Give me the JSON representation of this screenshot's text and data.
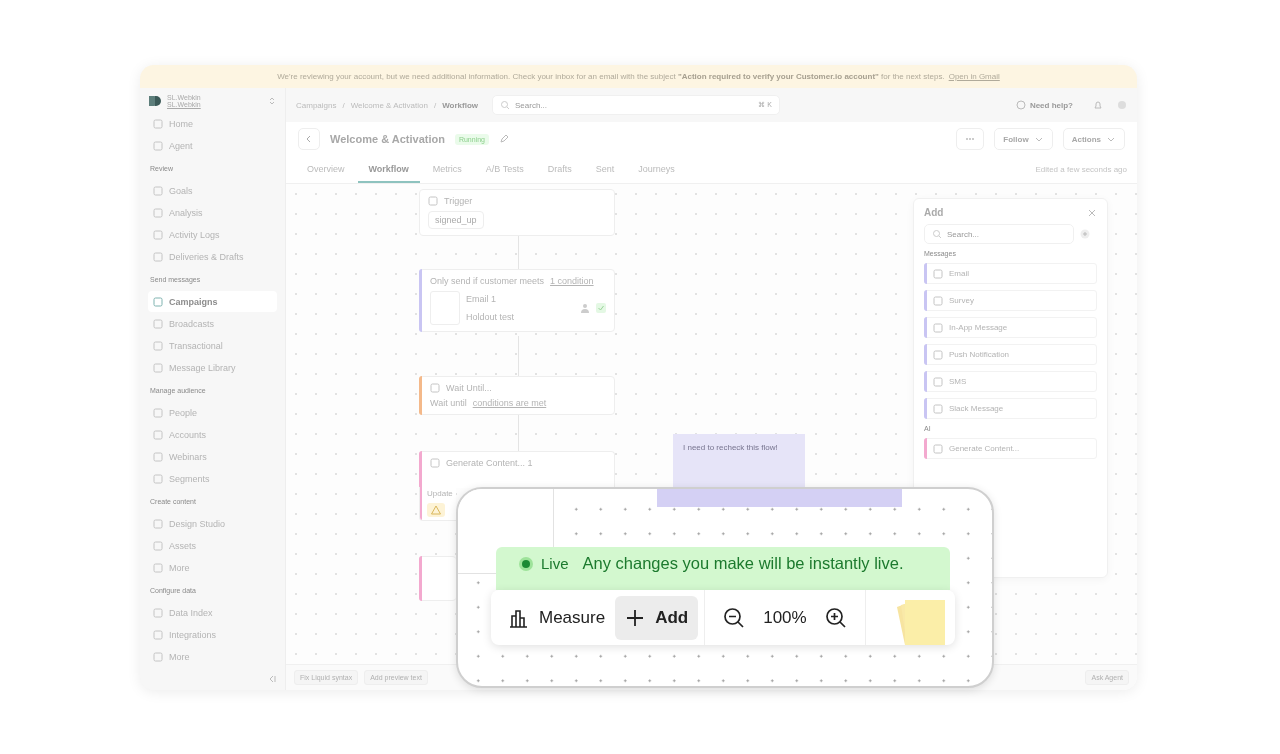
{
  "banner": {
    "text": "We're reviewing your account, but we need additional information. Check your inbox for an email with the subject **\"Action required to verify your Customer.io account\"** for the next steps.",
    "link": "Open in Gmail"
  },
  "workspace": {
    "name": "SL.Webkin",
    "account": "SL.Webkin"
  },
  "sidebar": {
    "items": [
      {
        "label": "Home",
        "selected": false
      },
      {
        "label": "Agent",
        "selected": false
      }
    ],
    "sections": [
      {
        "title": "Review",
        "items": [
          {
            "label": "Goals",
            "selected": false
          },
          {
            "label": "Analysis",
            "selected": false
          },
          {
            "label": "Activity Logs",
            "selected": false
          },
          {
            "label": "Deliveries & Drafts",
            "selected": false
          }
        ]
      },
      {
        "title": "Send messages",
        "items": [
          {
            "label": "Campaigns",
            "selected": true
          },
          {
            "label": "Broadcasts",
            "selected": false
          },
          {
            "label": "Transactional",
            "selected": false
          },
          {
            "label": "Message Library",
            "selected": false
          }
        ]
      },
      {
        "title": "Manage audience",
        "items": [
          {
            "label": "People",
            "selected": false
          },
          {
            "label": "Accounts",
            "selected": false
          },
          {
            "label": "Webinars",
            "selected": false
          },
          {
            "label": "Segments",
            "selected": false
          }
        ]
      },
      {
        "title": "Create content",
        "items": [
          {
            "label": "Design Studio",
            "selected": false
          },
          {
            "label": "Assets",
            "selected": false
          },
          {
            "label": "More",
            "selected": false
          }
        ]
      },
      {
        "title": "Configure data",
        "items": [
          {
            "label": "Data Index",
            "selected": false
          },
          {
            "label": "Integrations",
            "selected": false
          },
          {
            "label": "More",
            "selected": false
          }
        ]
      }
    ]
  },
  "breadcrumbs": [
    {
      "label": "Campaigns"
    },
    {
      "separator": "/",
      "label": "Welcome & Activation"
    },
    {
      "separator": "/",
      "label": "Workflow"
    }
  ],
  "search": {
    "placeholder": "Search...",
    "shortcut": "⌘ K"
  },
  "help": "Need help?",
  "campaign": {
    "title": "Welcome & Activation",
    "status": "Running",
    "buttons": [
      "Follow",
      "Actions"
    ]
  },
  "tabs": [
    {
      "label": "Overview",
      "selected": false
    },
    {
      "label": "Workflow",
      "selected": true
    },
    {
      "label": "Metrics",
      "selected": false
    },
    {
      "label": "A/B Tests",
      "selected": false
    },
    {
      "label": "Drafts",
      "selected": false
    },
    {
      "label": "Sent",
      "selected": false
    },
    {
      "label": "Journeys",
      "selected": false
    }
  ],
  "edited": "Edited a few seconds ago",
  "nodes": [
    {
      "kind": "trigger",
      "title": "Trigger",
      "chip": "signed_up"
    },
    {
      "kind": "email",
      "color": "#c9c5f3",
      "condition": "Only send if customer meets ",
      "condition_link": "1 condition",
      "title": "Email 1",
      "subtitle": "Holdout test"
    },
    {
      "kind": "wait",
      "color": "#f4b98a",
      "title": "Wait Until...",
      "text": "Wait until ",
      "link": "conditions are met"
    },
    {
      "kind": "generate",
      "color": "#f3a9cf",
      "title": "Generate Content... 1",
      "text": "Update"
    },
    {
      "kind": "blank",
      "color": "#f3a9cf"
    }
  ],
  "note": {
    "text": "I need to recheck this flow!"
  },
  "add_panel": {
    "title": "Add",
    "search_placeholder": "Search...",
    "sections": [
      {
        "title": "Messages",
        "color": "#c9c5f3",
        "items": [
          "Email",
          "Survey",
          "In-App Message",
          "Push Notification",
          "SMS",
          "Slack Message"
        ]
      },
      {
        "title": "AI",
        "color": "#f3a9cf",
        "items": [
          "Generate Content..."
        ]
      }
    ]
  },
  "footer": {
    "actions": [
      "Fix Liquid syntax",
      "Add preview text"
    ],
    "agent": "Ask Agent"
  },
  "inset": {
    "live": {
      "label": "Live",
      "message": "Any changes you make will be instantly live."
    },
    "toolbar": {
      "measure": "Measure",
      "add": "Add",
      "zoom": "100%"
    }
  }
}
